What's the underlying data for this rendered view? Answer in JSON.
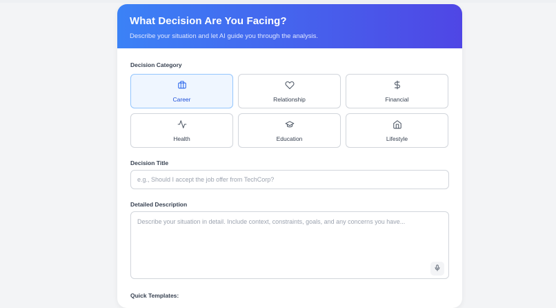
{
  "header": {
    "title": "What Decision Are You Facing?",
    "subtitle": "Describe your situation and let AI guide you through the analysis."
  },
  "category": {
    "label": "Decision Category",
    "selected": "Career",
    "options": [
      {
        "label": "Career",
        "icon": "briefcase-icon"
      },
      {
        "label": "Relationship",
        "icon": "heart-icon"
      },
      {
        "label": "Financial",
        "icon": "dollar-icon"
      },
      {
        "label": "Health",
        "icon": "activity-icon"
      },
      {
        "label": "Education",
        "icon": "graduation-cap-icon"
      },
      {
        "label": "Lifestyle",
        "icon": "home-icon"
      }
    ]
  },
  "title_field": {
    "label": "Decision Title",
    "placeholder": "e.g., Should I accept the job offer from TechCorp?",
    "value": ""
  },
  "description_field": {
    "label": "Detailed Description",
    "placeholder": "Describe your situation in detail. Include context, constraints, goals, and any concerns you have...",
    "value": "",
    "mic_icon": "microphone-icon"
  },
  "templates": {
    "label": "Quick Templates:"
  },
  "colors": {
    "header_gradient_start": "#3b82f6",
    "header_gradient_end": "#4f46e5",
    "accent": "#2563eb",
    "selected_bg": "#eff6ff"
  }
}
